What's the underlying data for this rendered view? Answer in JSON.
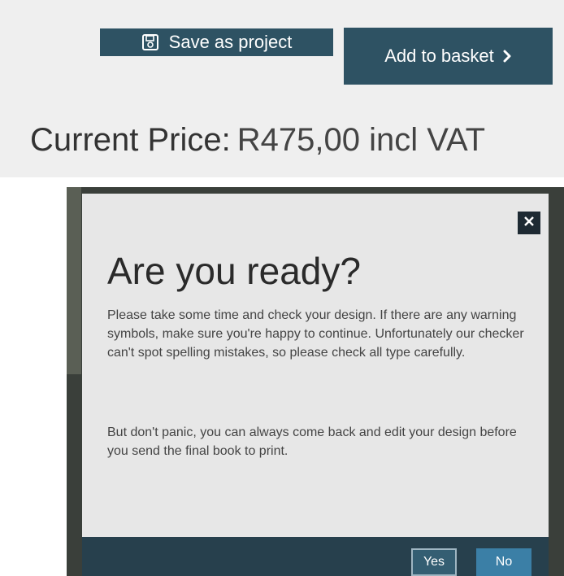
{
  "toolbar": {
    "save_label": "Save as project",
    "save_icon": "floppy-disk-icon",
    "basket_label": "Add to basket",
    "basket_icon": "chevron-right-icon"
  },
  "price": {
    "label": "Current Price:",
    "value": "R475,00 incl VAT"
  },
  "modal": {
    "close_icon": "close-icon",
    "title": "Are you ready?",
    "paragraph1": "Please take some time and check your design. If there are any warning symbols, make sure you're happy to continue. Unfortunately our checker can't spot spelling mistakes, so please check all type carefully.",
    "paragraph2": "But don't panic, you can always come back and edit your design before you send the final book to print.",
    "yes_label": "Yes",
    "no_label": "No"
  },
  "colors": {
    "button_bg": "#2e5263",
    "modal_bg": "#e7e7e7",
    "footer_bg": "#27404d",
    "no_button_bg": "#3b7fa6"
  }
}
